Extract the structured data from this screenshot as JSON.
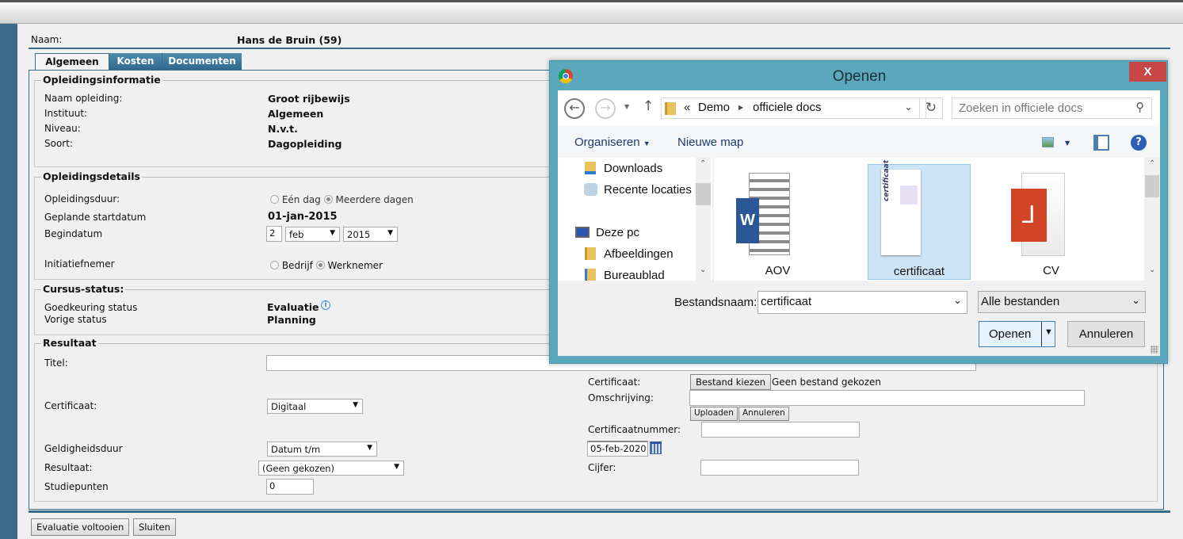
{
  "header": {
    "name_label": "Naam:",
    "name_value": "Hans de Bruin (59)"
  },
  "tabs": [
    {
      "label": "Algemeen",
      "active": true
    },
    {
      "label": "Kosten"
    },
    {
      "label": "Documenten"
    }
  ],
  "opleidingsinformatie": {
    "legend": "Opleidingsinformatie",
    "rows": [
      {
        "label": "Naam opleiding:",
        "value": "Groot rijbewijs"
      },
      {
        "label": "Instituut:",
        "value": "Algemeen"
      },
      {
        "label": "Niveau:",
        "value": "N.v.t."
      },
      {
        "label": "Soort:",
        "value": "Dagopleiding"
      }
    ]
  },
  "opleidingsdetails": {
    "legend": "Opleidingsdetails",
    "duur_label": "Opleidingsduur:",
    "duur_options": [
      "Eén dag",
      "Meerdere dagen"
    ],
    "duur_selected": "Meerdere dagen",
    "gepland_label": "Geplande startdatum",
    "gepland_value": "01-jan-2015",
    "begin_label": "Begindatum",
    "begin_day": "2",
    "begin_month": "feb",
    "begin_year": "2015",
    "init_label": "Initiatiefnemer",
    "init_options": [
      "Bedrijf",
      "Werknemer"
    ],
    "init_selected": "Werknemer"
  },
  "cursus_status": {
    "legend": "Cursus-status:",
    "goedkeuring_label": "Goedkeuring status",
    "goedkeuring_value": "Evaluatie",
    "vorige_label": "Vorige status",
    "vorige_value": "Planning"
  },
  "resultaat": {
    "legend": "Resultaat",
    "titel_label": "Titel:",
    "titel_value": "",
    "certificaat_label": "Certificaat:",
    "certificaat_value": "Digitaal",
    "geldigheid_label": "Geldigheidsduur",
    "geldigheid_value": "Datum t/m",
    "resultaat_label": "Resultaat:",
    "resultaat_value": "(Geen gekozen)",
    "studiepunten_label": "Studiepunten",
    "studiepunten_value": "0",
    "cert_file_label": "Certificaat:",
    "file_button": "Bestand kiezen",
    "file_status": "Geen bestand gekozen",
    "omschrijving_label": "Omschrijving:",
    "upload_button": "Uploaden",
    "annuleren_button": "Annuleren",
    "certnummer_label": "Certificaatnummer:",
    "datum_value": "05-feb-2020",
    "cijfer_label": "Cijfer:"
  },
  "footer": {
    "voltooien": "Evaluatie voltooien",
    "sluiten": "Sluiten"
  },
  "dialog": {
    "title": "Openen",
    "close": "X",
    "path": [
      "Demo",
      "officiele docs"
    ],
    "path_prefix": "«",
    "search_placeholder": "Zoeken in officiele docs",
    "organiseren": "Organiseren",
    "nieuwe_map": "Nieuwe map",
    "nav": [
      "Downloads",
      "Recente locaties",
      "Deze pc",
      "Afbeeldingen",
      "Bureaublad"
    ],
    "files": [
      {
        "name": "AOV",
        "type": "word"
      },
      {
        "name": "certificaat",
        "type": "image",
        "selected": true
      },
      {
        "name": "CV",
        "type": "pdf"
      }
    ],
    "filename_label": "Bestandsnaam:",
    "filename_value": "certificaat",
    "filter_value": "Alle bestanden",
    "open_button": "Openen",
    "cancel_button": "Annuleren",
    "accent": "#5ba8bd"
  }
}
